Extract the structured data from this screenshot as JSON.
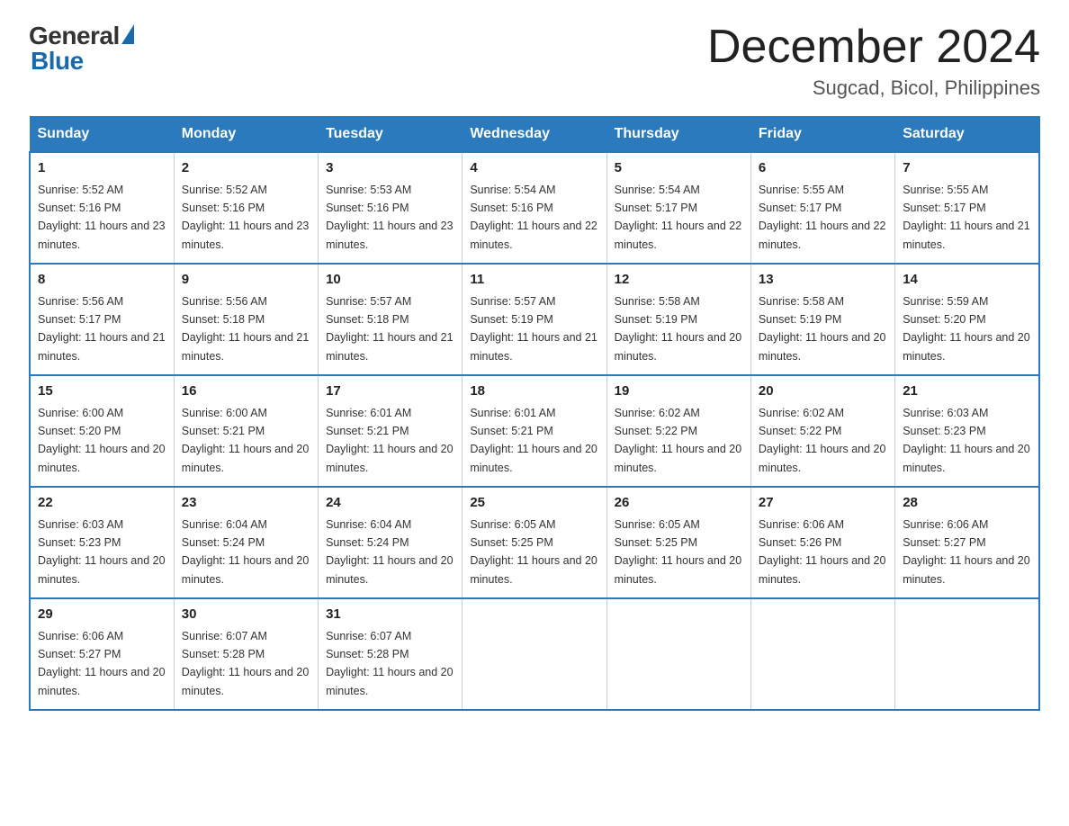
{
  "header": {
    "logo_general": "General",
    "logo_blue": "Blue",
    "main_title": "December 2024",
    "subtitle": "Sugcad, Bicol, Philippines"
  },
  "calendar": {
    "days_of_week": [
      "Sunday",
      "Monday",
      "Tuesday",
      "Wednesday",
      "Thursday",
      "Friday",
      "Saturday"
    ],
    "weeks": [
      [
        {
          "day": "1",
          "sunrise": "5:52 AM",
          "sunset": "5:16 PM",
          "daylight": "11 hours and 23 minutes."
        },
        {
          "day": "2",
          "sunrise": "5:52 AM",
          "sunset": "5:16 PM",
          "daylight": "11 hours and 23 minutes."
        },
        {
          "day": "3",
          "sunrise": "5:53 AM",
          "sunset": "5:16 PM",
          "daylight": "11 hours and 23 minutes."
        },
        {
          "day": "4",
          "sunrise": "5:54 AM",
          "sunset": "5:16 PM",
          "daylight": "11 hours and 22 minutes."
        },
        {
          "day": "5",
          "sunrise": "5:54 AM",
          "sunset": "5:17 PM",
          "daylight": "11 hours and 22 minutes."
        },
        {
          "day": "6",
          "sunrise": "5:55 AM",
          "sunset": "5:17 PM",
          "daylight": "11 hours and 22 minutes."
        },
        {
          "day": "7",
          "sunrise": "5:55 AM",
          "sunset": "5:17 PM",
          "daylight": "11 hours and 21 minutes."
        }
      ],
      [
        {
          "day": "8",
          "sunrise": "5:56 AM",
          "sunset": "5:17 PM",
          "daylight": "11 hours and 21 minutes."
        },
        {
          "day": "9",
          "sunrise": "5:56 AM",
          "sunset": "5:18 PM",
          "daylight": "11 hours and 21 minutes."
        },
        {
          "day": "10",
          "sunrise": "5:57 AM",
          "sunset": "5:18 PM",
          "daylight": "11 hours and 21 minutes."
        },
        {
          "day": "11",
          "sunrise": "5:57 AM",
          "sunset": "5:19 PM",
          "daylight": "11 hours and 21 minutes."
        },
        {
          "day": "12",
          "sunrise": "5:58 AM",
          "sunset": "5:19 PM",
          "daylight": "11 hours and 20 minutes."
        },
        {
          "day": "13",
          "sunrise": "5:58 AM",
          "sunset": "5:19 PM",
          "daylight": "11 hours and 20 minutes."
        },
        {
          "day": "14",
          "sunrise": "5:59 AM",
          "sunset": "5:20 PM",
          "daylight": "11 hours and 20 minutes."
        }
      ],
      [
        {
          "day": "15",
          "sunrise": "6:00 AM",
          "sunset": "5:20 PM",
          "daylight": "11 hours and 20 minutes."
        },
        {
          "day": "16",
          "sunrise": "6:00 AM",
          "sunset": "5:21 PM",
          "daylight": "11 hours and 20 minutes."
        },
        {
          "day": "17",
          "sunrise": "6:01 AM",
          "sunset": "5:21 PM",
          "daylight": "11 hours and 20 minutes."
        },
        {
          "day": "18",
          "sunrise": "6:01 AM",
          "sunset": "5:21 PM",
          "daylight": "11 hours and 20 minutes."
        },
        {
          "day": "19",
          "sunrise": "6:02 AM",
          "sunset": "5:22 PM",
          "daylight": "11 hours and 20 minutes."
        },
        {
          "day": "20",
          "sunrise": "6:02 AM",
          "sunset": "5:22 PM",
          "daylight": "11 hours and 20 minutes."
        },
        {
          "day": "21",
          "sunrise": "6:03 AM",
          "sunset": "5:23 PM",
          "daylight": "11 hours and 20 minutes."
        }
      ],
      [
        {
          "day": "22",
          "sunrise": "6:03 AM",
          "sunset": "5:23 PM",
          "daylight": "11 hours and 20 minutes."
        },
        {
          "day": "23",
          "sunrise": "6:04 AM",
          "sunset": "5:24 PM",
          "daylight": "11 hours and 20 minutes."
        },
        {
          "day": "24",
          "sunrise": "6:04 AM",
          "sunset": "5:24 PM",
          "daylight": "11 hours and 20 minutes."
        },
        {
          "day": "25",
          "sunrise": "6:05 AM",
          "sunset": "5:25 PM",
          "daylight": "11 hours and 20 minutes."
        },
        {
          "day": "26",
          "sunrise": "6:05 AM",
          "sunset": "5:25 PM",
          "daylight": "11 hours and 20 minutes."
        },
        {
          "day": "27",
          "sunrise": "6:06 AM",
          "sunset": "5:26 PM",
          "daylight": "11 hours and 20 minutes."
        },
        {
          "day": "28",
          "sunrise": "6:06 AM",
          "sunset": "5:27 PM",
          "daylight": "11 hours and 20 minutes."
        }
      ],
      [
        {
          "day": "29",
          "sunrise": "6:06 AM",
          "sunset": "5:27 PM",
          "daylight": "11 hours and 20 minutes."
        },
        {
          "day": "30",
          "sunrise": "6:07 AM",
          "sunset": "5:28 PM",
          "daylight": "11 hours and 20 minutes."
        },
        {
          "day": "31",
          "sunrise": "6:07 AM",
          "sunset": "5:28 PM",
          "daylight": "11 hours and 20 minutes."
        },
        null,
        null,
        null,
        null
      ]
    ]
  }
}
